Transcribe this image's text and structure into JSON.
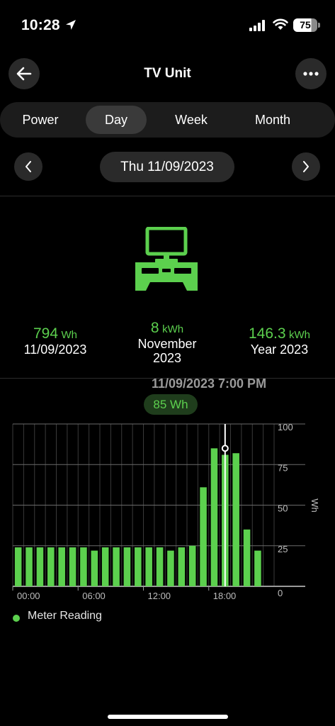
{
  "status_bar": {
    "time": "10:28",
    "battery": "75",
    "battery_level": 0.75
  },
  "header": {
    "title": "TV Unit",
    "back_icon": "arrow-left-icon",
    "more_icon": "more-horizontal-icon"
  },
  "tabs": [
    {
      "label": "Power",
      "active": false
    },
    {
      "label": "Day",
      "active": true
    },
    {
      "label": "Week",
      "active": false
    },
    {
      "label": "Month",
      "active": false
    }
  ],
  "date_nav": {
    "date": "Thu 11/09/2023",
    "prev_icon": "chevron-left-icon",
    "next_icon": "chevron-right-icon"
  },
  "device_icon": "tv-unit-icon",
  "stats": [
    {
      "value": "794",
      "unit": "Wh",
      "label_line1": "11/09/2023",
      "label_line2": ""
    },
    {
      "value": "8",
      "unit": "kWh",
      "label_line1": "November",
      "label_line2": "2023"
    },
    {
      "value": "146.3",
      "unit": "kWh",
      "label_line1": "Year 2023",
      "label_line2": ""
    }
  ],
  "selection": {
    "datetime": "11/09/2023 7:00 PM",
    "value": "85 Wh"
  },
  "colors": {
    "accent": "#5cd04e",
    "background": "#000000",
    "surface": "#2a2a2a"
  },
  "chart_data": {
    "type": "bar",
    "categories": [
      "00:00",
      "01:00",
      "02:00",
      "03:00",
      "04:00",
      "05:00",
      "06:00",
      "07:00",
      "08:00",
      "09:00",
      "10:00",
      "11:00",
      "12:00",
      "13:00",
      "14:00",
      "15:00",
      "16:00",
      "17:00",
      "18:00",
      "19:00",
      "20:00",
      "21:00",
      "22:00",
      "23:00"
    ],
    "values": [
      24,
      24,
      24,
      24,
      24,
      24,
      24,
      22,
      24,
      24,
      24,
      24,
      24,
      24,
      22,
      24,
      25,
      61,
      85,
      81,
      82,
      35,
      22,
      0
    ],
    "x_tick_labels": [
      "00:00",
      "06:00",
      "12:00",
      "18:00"
    ],
    "y_ticks": [
      "0",
      "25",
      "50",
      "75",
      "100"
    ],
    "ylabel": "Wh",
    "ylim": [
      0,
      100
    ],
    "selected_index": 19,
    "grid": true
  },
  "legend": {
    "label": "Meter Reading"
  }
}
